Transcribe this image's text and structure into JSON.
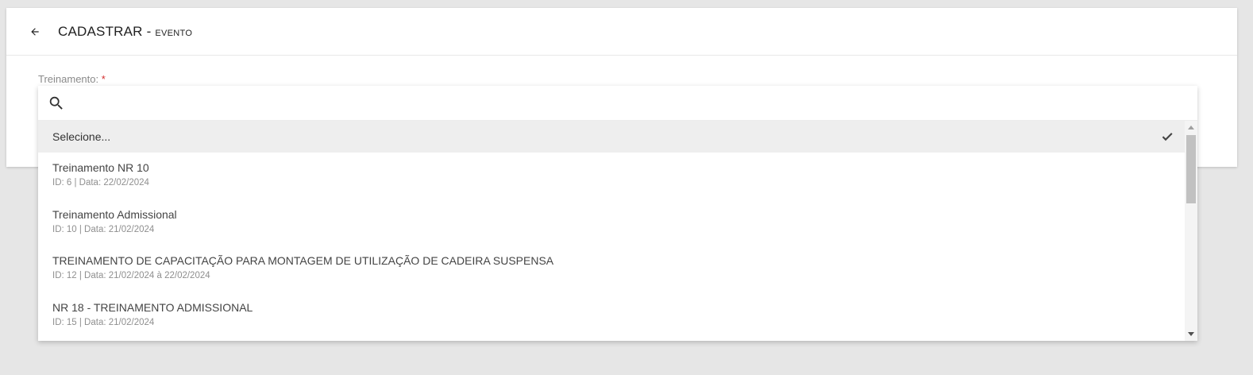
{
  "header": {
    "title": "CADASTRAR -",
    "subtitle": "EVENTO",
    "back_icon": "arrow-left-icon"
  },
  "form": {
    "field_label": "Treinamento:",
    "required_mark": "*"
  },
  "dropdown": {
    "search_placeholder": "",
    "search_value": "",
    "selected_option": "Selecione...",
    "options": [
      {
        "title": "Treinamento NR 10",
        "meta": "ID: 6 | Data: 22/02/2024"
      },
      {
        "title": "Treinamento Admissional",
        "meta": "ID: 10 | Data: 21/02/2024"
      },
      {
        "title": "TREINAMENTO DE CAPACITAÇÃO PARA MONTAGEM DE UTILIZAÇÃO DE CADEIRA SUSPENSA",
        "meta": "ID: 12 | Data: 21/02/2024 à 22/02/2024"
      },
      {
        "title": "NR 18 - TREINAMENTO ADMISSIONAL",
        "meta": "ID: 15 | Data: 21/02/2024"
      }
    ]
  },
  "colors": {
    "required": "#d32f2f",
    "selected_bg": "#eeeeee",
    "page_bg": "#e6e6e6"
  }
}
